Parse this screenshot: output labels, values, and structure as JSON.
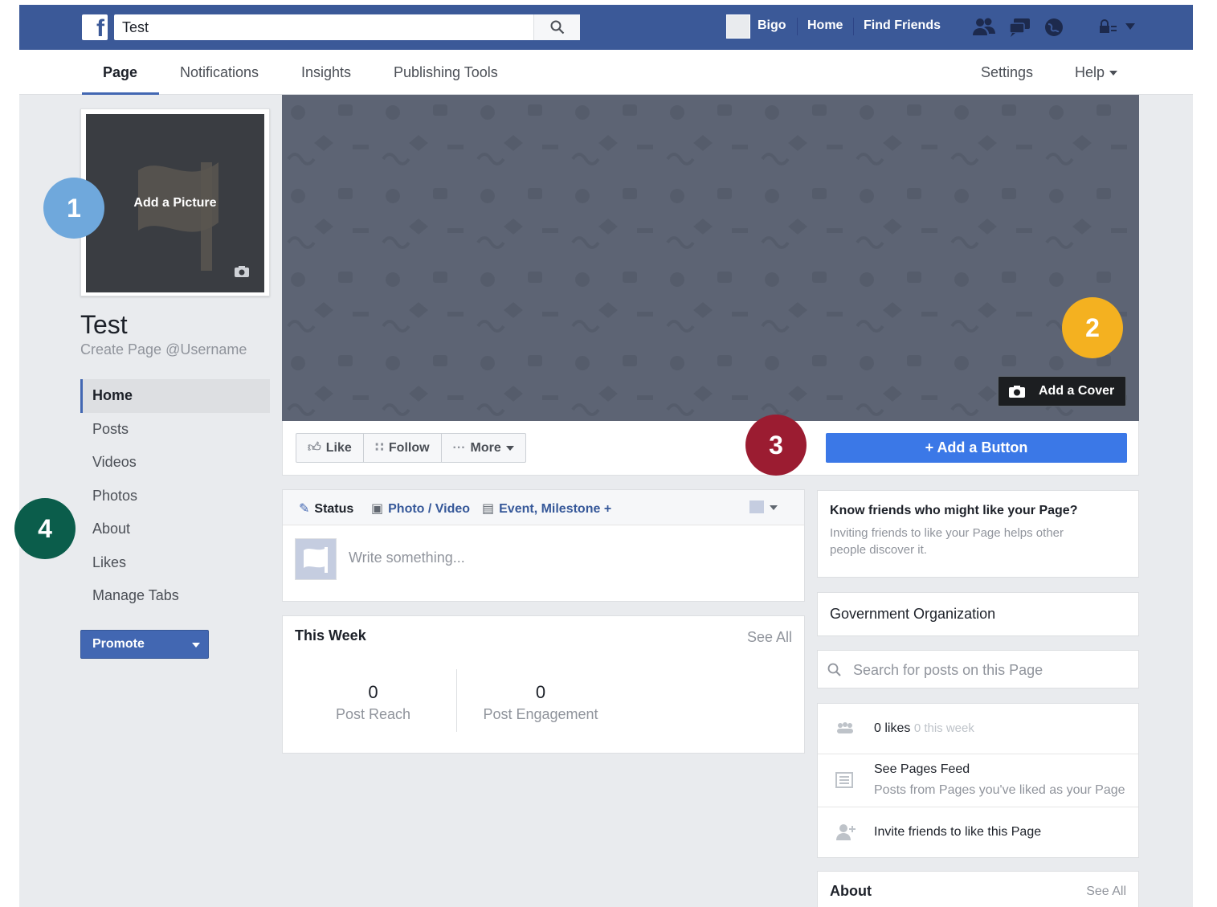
{
  "topbar": {
    "logo": "f",
    "search_value": "Test",
    "user_name": "Bigo",
    "links": [
      "Home",
      "Find Friends"
    ],
    "icons": [
      "friends-icon",
      "messages-icon",
      "notifications-globe-icon",
      "privacy-lock-icon",
      "dropdown-caret-icon"
    ]
  },
  "pagenav": {
    "tabs": [
      "Page",
      "Notifications",
      "Insights",
      "Publishing Tools"
    ],
    "right_tabs": [
      "Settings",
      "Help"
    ]
  },
  "profile": {
    "add_picture_label": "Add a Picture",
    "page_name": "Test",
    "username_link": "Create Page @Username"
  },
  "leftnav": {
    "items": [
      "Home",
      "Posts",
      "Videos",
      "Photos",
      "About",
      "Likes",
      "Manage Tabs"
    ],
    "promote_label": "Promote"
  },
  "cover": {
    "add_cover_label": "Add a Cover"
  },
  "actions": {
    "like": "Like",
    "follow": "Follow",
    "more": "More",
    "add_button": "Add a Button",
    "add_button_plus": "+"
  },
  "composer": {
    "status": "Status",
    "photo_video": "Photo / Video",
    "event": "Event, Milestone +",
    "placeholder": "Write something..."
  },
  "this_week": {
    "title": "This Week",
    "see_all": "See All",
    "post_reach_value": "0",
    "post_reach_label": "Post Reach",
    "post_engagement_value": "0",
    "post_engagement_label": "Post Engagement"
  },
  "sidebar": {
    "know_title": "Know friends who might like your Page?",
    "know_body": "Inviting friends to like your Page helps other people discover it.",
    "category": "Government Organization",
    "search_placeholder": "Search for posts on this Page",
    "likes_count": "0 likes",
    "likes_week": "0 this week",
    "pages_feed_title": "See Pages Feed",
    "pages_feed_sub": "Posts from Pages you've liked as your Page",
    "invite": "Invite friends to like this Page",
    "about_title": "About",
    "about_see_all": "See All"
  },
  "markers": {
    "m1": "1",
    "m2": "2",
    "m3": "3",
    "m4": "4",
    "colors": [
      "#6fa8dc",
      "#f4b120",
      "#9b1c31",
      "#0b5d4b"
    ]
  }
}
